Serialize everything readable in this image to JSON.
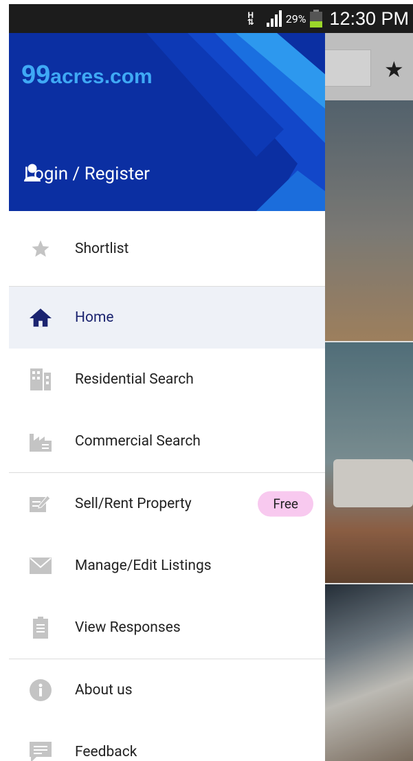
{
  "status_bar": {
    "network": "H",
    "battery": "29%",
    "time": "12:30 PM"
  },
  "drawer": {
    "logo_number": "99",
    "logo_word": "acres.com",
    "login_label": "Login / Register",
    "menu": [
      {
        "label": "Shortlist",
        "icon": "star-icon"
      },
      {
        "label": "Home",
        "icon": "home-icon",
        "active": true
      },
      {
        "label": "Residential Search",
        "icon": "building-icon"
      },
      {
        "label": "Commercial Search",
        "icon": "factory-icon"
      },
      {
        "label": "Sell/Rent Property",
        "icon": "edit-icon",
        "badge": "Free"
      },
      {
        "label": "Manage/Edit Listings",
        "icon": "envelope-icon"
      },
      {
        "label": "View Responses",
        "icon": "document-icon"
      },
      {
        "label": "About us",
        "icon": "info-icon"
      },
      {
        "label": "Feedback",
        "icon": "chat-icon"
      }
    ]
  },
  "colors": {
    "header": "#0b2fa2",
    "logo": "#3fa9f5",
    "active_bg": "#eef1f7",
    "badge_bg": "#f8c9ef",
    "icon_gray": "#bdbdbd"
  }
}
